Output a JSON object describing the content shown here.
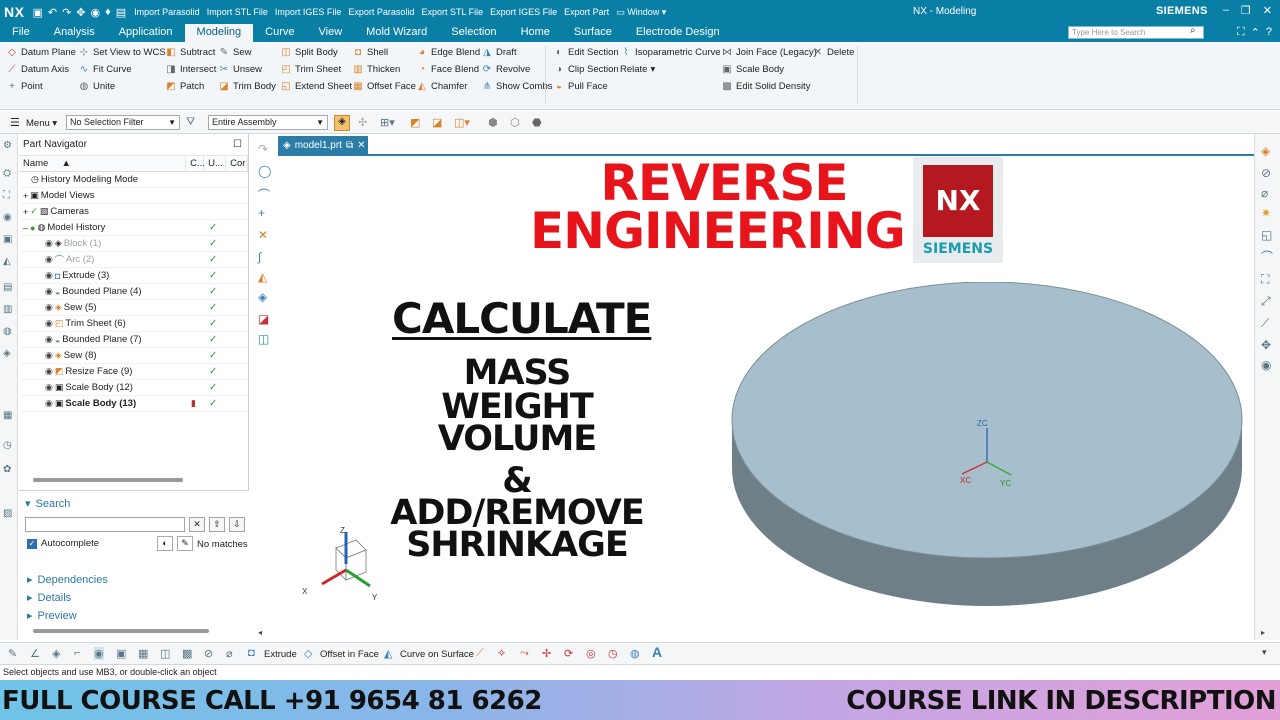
{
  "titlebar": {
    "logo": "NX",
    "commands": [
      "Import Parasolid",
      "Import STL File",
      "Import IGES File",
      "Export Parasolid",
      "Export STL File",
      "Export IGES File",
      "Export Part"
    ],
    "window_menu": "Window",
    "title": "NX - Modeling",
    "brand": "SIEMENS"
  },
  "tabs": {
    "items": [
      "File",
      "Analysis",
      "Application",
      "Modeling",
      "Curve",
      "View",
      "Mold Wizard",
      "Selection",
      "Home",
      "Surface",
      "Electrode Design"
    ],
    "active": "Modeling",
    "search_placeholder": "Type Here to Search"
  },
  "ribbon": {
    "col1": [
      "Datum Plane",
      "Datum Axis",
      "Point"
    ],
    "col2": [
      "Set View to WCS",
      "Fit Curve",
      "Unite"
    ],
    "col3": [
      "Subtract",
      "Intersect",
      "Patch"
    ],
    "col4": [
      "Sew",
      "Unsew",
      "Trim Body"
    ],
    "col5": [
      "Split Body",
      "Trim Sheet",
      "Extend Sheet"
    ],
    "col6": [
      "Shell",
      "Thicken",
      "Offset Face"
    ],
    "col7": [
      "Edge Blend",
      "Face Blend",
      "Chamfer"
    ],
    "col8": [
      "Draft",
      "Revolve",
      "Show Combs"
    ],
    "col9": [
      "Edit Section",
      "Clip Section",
      "Pull Face"
    ],
    "col10": [
      "Isoparametric Curve",
      "Relate"
    ],
    "col11": [
      "Join Face (Legacy)",
      "Scale Body",
      "Edit Solid Density"
    ],
    "col12": [
      "Delete"
    ]
  },
  "toolbar": {
    "menu": "Menu",
    "selection_filter": "No Selection Filter",
    "scope": "Entire Assembly"
  },
  "navigator": {
    "title": "Part Navigator",
    "columns": [
      "Name",
      "C...",
      "U...",
      "Cor"
    ],
    "rows": [
      {
        "label": "History Modeling Mode",
        "style": "normal"
      },
      {
        "label": "Model Views",
        "style": "normal"
      },
      {
        "label": "Cameras",
        "style": "normal"
      },
      {
        "label": "Model History",
        "style": "normal"
      },
      {
        "label": "Block (1)",
        "style": "grey"
      },
      {
        "label": "Arc (2)",
        "style": "grey"
      },
      {
        "label": "Extrude (3)",
        "style": "normal"
      },
      {
        "label": "Bounded Plane (4)",
        "style": "normal"
      },
      {
        "label": "Sew (5)",
        "style": "normal"
      },
      {
        "label": "Trim Sheet (6)",
        "style": "normal"
      },
      {
        "label": "Bounded Plane (7)",
        "style": "normal"
      },
      {
        "label": "Sew (8)",
        "style": "normal"
      },
      {
        "label": "Resize Face (9)",
        "style": "normal"
      },
      {
        "label": "Scale Body (12)",
        "style": "normal"
      },
      {
        "label": "Scale Body (13)",
        "style": "bold"
      }
    ]
  },
  "search_panel": {
    "title": "Search",
    "autocomplete": "Autocomplete",
    "no_matches": "No matches",
    "sections": [
      "Dependencies",
      "Details",
      "Preview"
    ]
  },
  "document": {
    "tab": "model1.prt"
  },
  "overlay": {
    "headline1": "REVERSE",
    "headline2": "ENGINEERING",
    "badge_nx": "NX",
    "badge_brand": "SIEMENS",
    "calculate": "CALCULATE",
    "items": [
      "MASS",
      "WEIGHT",
      "VOLUME",
      "&",
      "ADD/REMOVE",
      "SHRINKAGE"
    ]
  },
  "triad": {
    "x": "X",
    "y": "Y",
    "z": "Z",
    "xc": "XC",
    "yc": "YC",
    "zc": "ZC"
  },
  "bottom_toolbar": {
    "extrude": "Extrude",
    "offset_in_face": "Offset in Face",
    "curve_on_surface": "Curve on Surface"
  },
  "status": "Select objects and use MB3, or double-click an object",
  "banner": {
    "left": "FULL COURSE CALL +91 9654 81 6262",
    "right": "COURSE LINK IN DESCRIPTION"
  },
  "colors": {
    "nx_blue": "#0a7fa6",
    "headline_red": "#e8141c",
    "disc_fill": "#a7bfcc",
    "disc_side": "#6e7f88"
  }
}
